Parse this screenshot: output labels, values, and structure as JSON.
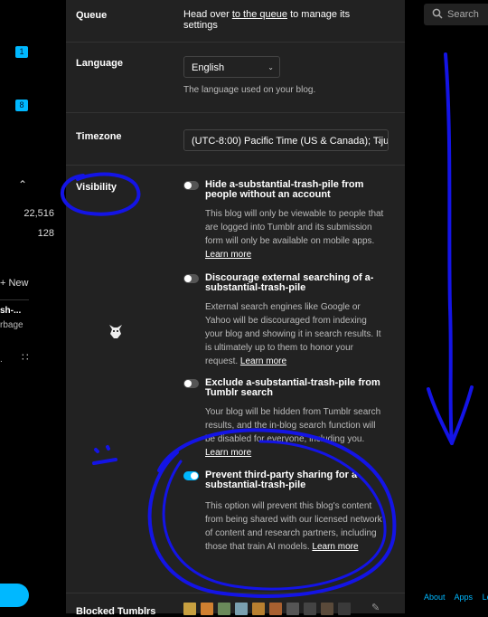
{
  "sidebar": {
    "badges": [
      "1",
      "8"
    ],
    "stats": [
      "22,516",
      "128"
    ],
    "new_label": "+ New",
    "blog_name": "sh-...",
    "blog_sub": "rbage",
    "more_icon": "dots-icon"
  },
  "settings": {
    "queue": {
      "label": "Queue",
      "text_before": "Head over",
      "link": "to the queue",
      "text_after": "to manage its settings"
    },
    "language": {
      "label": "Language",
      "selected": "English",
      "help": "The language used on your blog."
    },
    "timezone": {
      "label": "Timezone",
      "selected": "(UTC-8:00) Pacific Time (US & Canada); Tiju"
    },
    "visibility": {
      "label": "Visibility",
      "options": [
        {
          "title": "Hide a-substantial-trash-pile from people without an account",
          "desc": "This blog will only be viewable to people that are logged into Tumblr and its submission form will only be available on mobile apps.",
          "link": "Learn more",
          "on": false
        },
        {
          "title": "Discourage external searching of a-substantial-trash-pile",
          "desc": "External search engines like Google or Yahoo will be discouraged from indexing your blog and showing it in search results. It is ultimately up to them to honor your request.",
          "link": "Learn more",
          "on": false
        },
        {
          "title": "Exclude a-substantial-trash-pile from Tumblr search",
          "desc": "Your blog will be hidden from Tumblr search results, and the in-blog search function will be disabled for everyone, including you.",
          "link": "Learn more",
          "on": false
        },
        {
          "title": "Prevent third-party sharing for a-substantial-trash-pile",
          "desc": "This option will prevent this blog's content from being shared with our licensed network of content and research partners, including those that train AI models.",
          "link": "Learn more",
          "on": true
        }
      ]
    },
    "blocked": {
      "label": "Blocked Tumblrs"
    }
  },
  "search": {
    "placeholder": "Search"
  },
  "footer": {
    "links": [
      "About",
      "Apps",
      "Le"
    ]
  },
  "colors": {
    "accent": "#00b8ff",
    "annotation": "#1414e6",
    "panel": "#222222"
  }
}
